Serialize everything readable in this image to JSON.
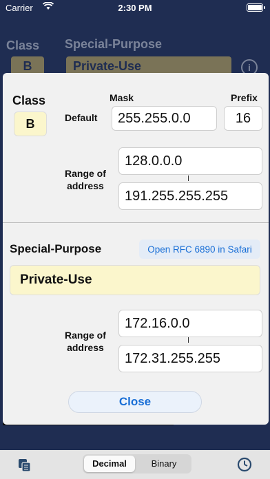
{
  "status": {
    "carrier": "Carrier",
    "time": "2:30 PM"
  },
  "background": {
    "class_label": "Class",
    "class_value": "B",
    "special_purpose_label": "Special-Purpose",
    "special_purpose_value": "Private-Use",
    "info_icon": "info-icon"
  },
  "class_section": {
    "title": "Class",
    "value": "B",
    "mask_label": "Mask",
    "prefix_label": "Prefix",
    "default_label": "Default",
    "mask_value": "255.255.0.0",
    "prefix_value": "16",
    "range_label_line1": "Range of",
    "range_label_line2": "address",
    "range_start": "128.0.0.0",
    "range_end": "191.255.255.255"
  },
  "special_section": {
    "title": "Special-Purpose",
    "rfc_button": "Open RFC 6890 in Safari",
    "value": "Private-Use",
    "range_label_line1": "Range of",
    "range_label_line2": "address",
    "range_start": "172.16.0.0",
    "range_end": "172.31.255.255"
  },
  "close_button": "Close",
  "bottom_bar": {
    "segments": [
      "Decimal",
      "Binary"
    ],
    "selected": "Decimal",
    "icons": [
      "copy-icon",
      "clock-icon"
    ]
  },
  "colors": {
    "background": "#1f2d52",
    "modal": "#f1f1f1",
    "accent": "#1a6fd6",
    "highlight": "#fbf6cc"
  }
}
